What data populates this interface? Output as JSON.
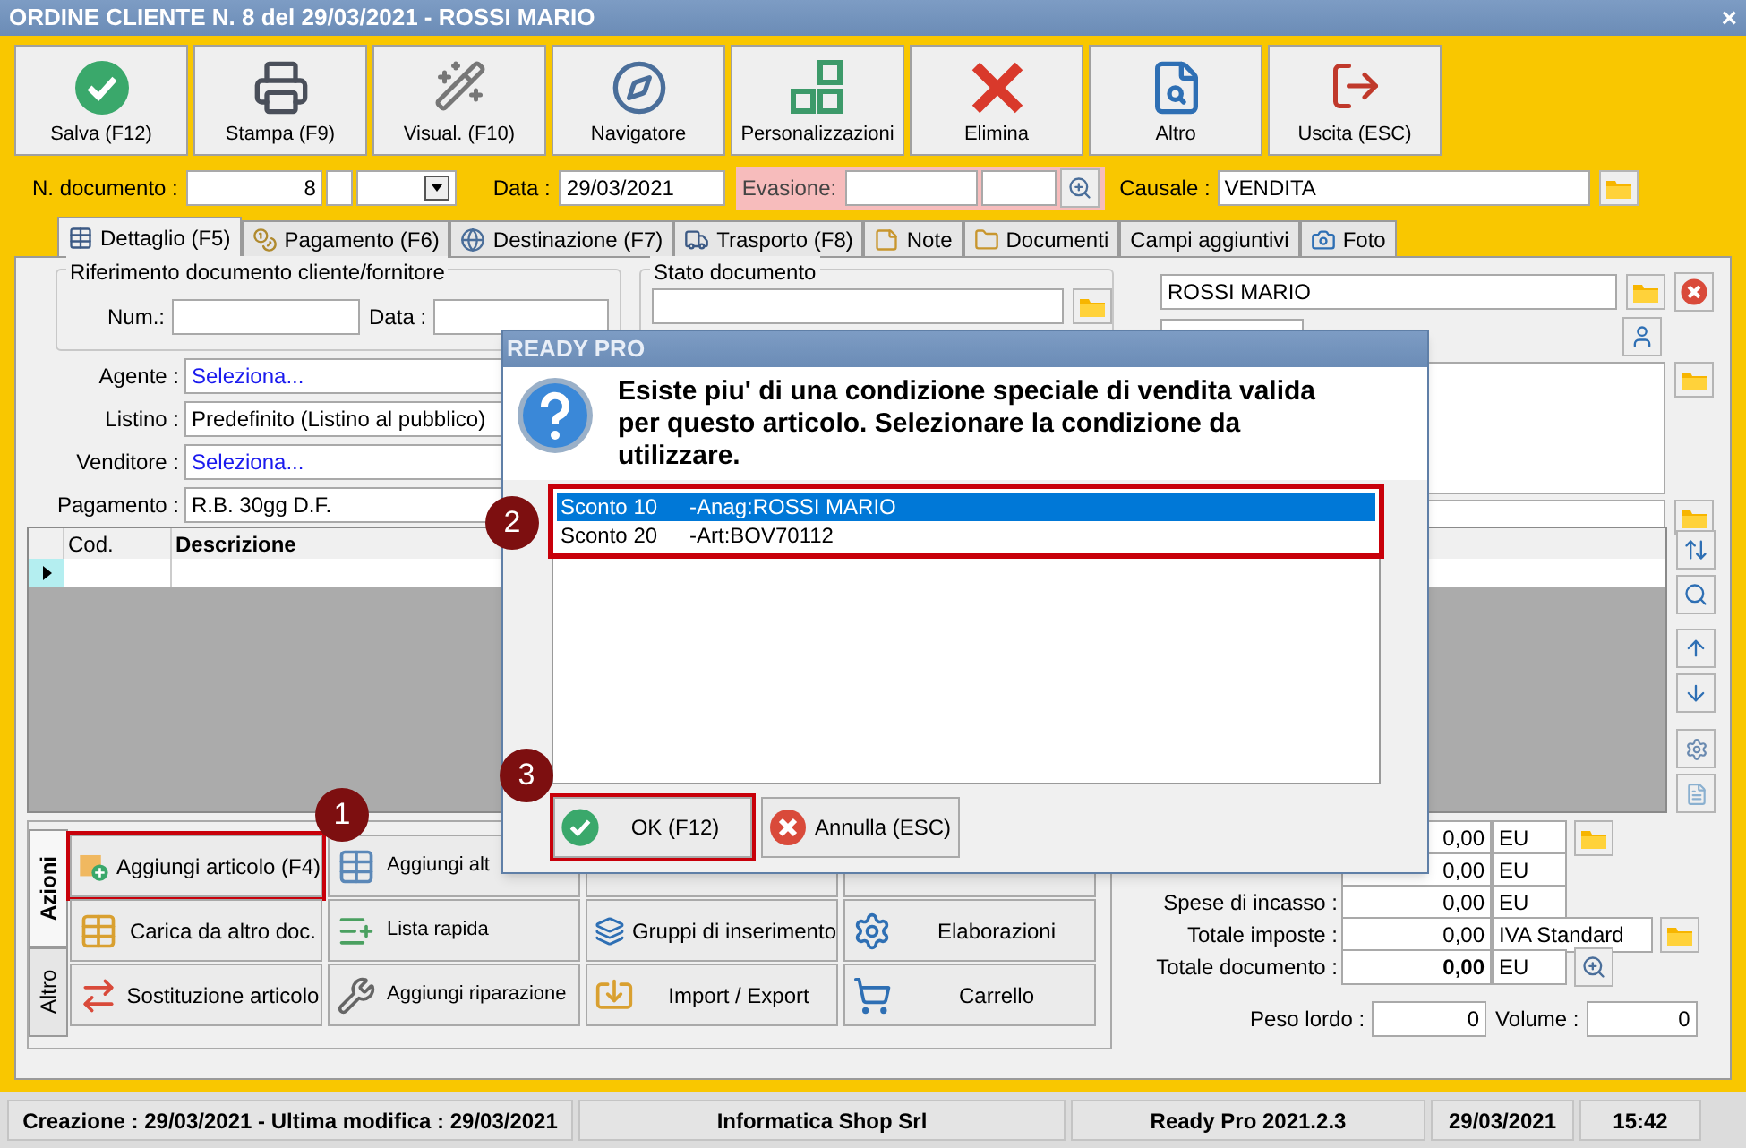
{
  "window": {
    "title": "ORDINE CLIENTE N. 8 del 29/03/2021 - ROSSI MARIO",
    "close": "×"
  },
  "toolbar": [
    {
      "label": "Salva (F12)",
      "kind": "save"
    },
    {
      "label": "Stampa (F9)",
      "kind": "print"
    },
    {
      "label": "Visual. (F10)",
      "kind": "view"
    },
    {
      "label": "Navigatore",
      "kind": "navigator"
    },
    {
      "label": "Personalizzazioni",
      "kind": "custom"
    },
    {
      "label": "Elimina",
      "kind": "delete"
    },
    {
      "label": "Altro",
      "kind": "other"
    },
    {
      "label": "Uscita (ESC)",
      "kind": "exit"
    }
  ],
  "document_row": {
    "number_label": "N. documento :",
    "number": "8",
    "date_label": "Data :",
    "date": "29/03/2021",
    "evasione_label": "Evasione:",
    "causale_label": "Causale :",
    "causale": "VENDITA"
  },
  "tabs": [
    {
      "label": "Dettaglio (F5)",
      "selected": true,
      "kind": "grid"
    },
    {
      "label": "Pagamento (F6)",
      "selected": false,
      "kind": "coins"
    },
    {
      "label": "Destinazione (F7)",
      "selected": false,
      "kind": "globe"
    },
    {
      "label": "Trasporto (F8)",
      "selected": false,
      "kind": "truck"
    },
    {
      "label": "Note",
      "selected": false,
      "kind": "note"
    },
    {
      "label": "Documenti",
      "selected": false,
      "kind": "folder"
    },
    {
      "label": "Campi aggiuntivi",
      "selected": false,
      "kind": "none"
    },
    {
      "label": "Foto",
      "selected": false,
      "kind": "camera"
    }
  ],
  "reference": {
    "title": "Riferimento documento cliente/fornitore",
    "num_label": "Num.:",
    "data_label": "Data :"
  },
  "status_group": {
    "title": "Stato documento"
  },
  "fields": [
    {
      "label": "Agente :",
      "value": "Seleziona...",
      "kind": "link"
    },
    {
      "label": "Listino :",
      "value": "Predefinito (Listino al pubblico)",
      "kind": "text"
    },
    {
      "label": "Venditore :",
      "value": "Seleziona...",
      "kind": "link"
    },
    {
      "label": "Pagamento :",
      "value": "R.B. 30gg D.F.",
      "kind": "text"
    }
  ],
  "customer": {
    "name": "ROSSI MARIO"
  },
  "grid": {
    "columns": [
      "Cod.",
      "Descrizione"
    ]
  },
  "action_tabs": [
    {
      "label": "Azioni",
      "selected": true
    },
    {
      "label": "Altro",
      "selected": false
    }
  ],
  "actions": [
    [
      {
        "label": "Aggiungi articolo (F4)",
        "kind": "add",
        "highlighted": true,
        "marker": "1"
      },
      {
        "label": "Aggiungi alt",
        "kind": "table",
        "highlighted": false
      }
    ],
    [
      {
        "label": "Carica da altro doc.",
        "kind": "load",
        "highlighted": false
      },
      {
        "label": "Lista rapida",
        "kind": "list",
        "highlighted": false
      },
      {
        "label": "Gruppi di inserimento",
        "kind": "group",
        "highlighted": false
      },
      {
        "label": "Elaborazioni",
        "kind": "process",
        "highlighted": false
      }
    ],
    [
      {
        "label": "Sostituzione articolo",
        "kind": "swap",
        "highlighted": false
      },
      {
        "label": "Aggiungi riparazione",
        "kind": "wrench",
        "highlighted": false
      },
      {
        "label": "Import / Export",
        "kind": "import",
        "highlighted": false
      },
      {
        "label": "Carrello",
        "kind": "cart",
        "highlighted": false
      }
    ]
  ],
  "totals": [
    {
      "value": "0,00",
      "unit": "EU",
      "kind": "folder",
      "bold": false
    },
    {
      "value": "0,00",
      "unit": "EU",
      "kind": "none",
      "bold": false
    },
    {
      "label": "Spese di incasso :",
      "value": "0,00",
      "unit": "EU",
      "kind": "none",
      "bold": false
    },
    {
      "label": "Totale imposte :",
      "value": "0,00",
      "unit": "IVA Standard",
      "kind": "folder",
      "bold": false
    },
    {
      "label": "Totale documento :",
      "value": "0,00",
      "unit": "EU",
      "kind": "zoom",
      "bold": true
    }
  ],
  "weights": {
    "peso_label": "Peso lordo :",
    "peso": "0",
    "volume_label": "Volume :",
    "volume": "0"
  },
  "status_bar": [
    "Creazione : 29/03/2021 - Ultima modifica : 29/03/2021",
    "Informatica Shop Srl",
    "Ready Pro 2021.2.3",
    "29/03/2021",
    "15:42"
  ],
  "dialog": {
    "title": "READY PRO",
    "message": "Esiste piu' di una condizione speciale di vendita valida per questo articolo. Selezionare la condizione da utilizzare.",
    "list_highlighted": true,
    "list_marker": "2",
    "options": [
      {
        "discount": "Sconto 10",
        "source": "-Anag:ROSSI MARIO",
        "selected": true
      },
      {
        "discount": "Sconto 20",
        "source": "-Art:BOV70112",
        "selected": false
      }
    ],
    "buttons": [
      {
        "label": "OK (F12)",
        "kind": "ok",
        "highlighted": true,
        "marker": "3"
      },
      {
        "label": "Annulla (ESC)",
        "kind": "cancel",
        "highlighted": false
      }
    ]
  }
}
